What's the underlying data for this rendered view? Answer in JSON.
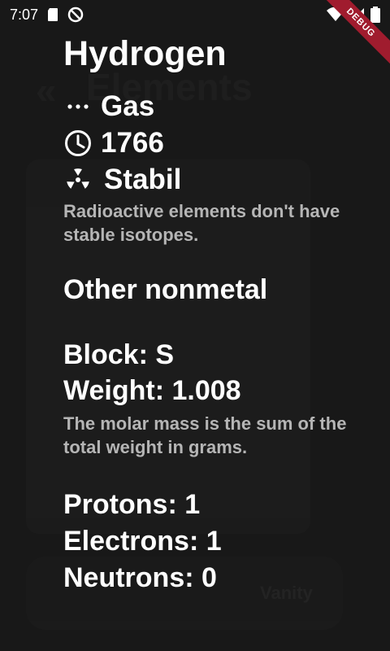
{
  "status_bar": {
    "time": "7:07"
  },
  "debug_banner": "DEBUG",
  "background": {
    "back_icon": "double-chevron-left-icon",
    "title": "Elements",
    "button_label": "Vanity"
  },
  "element": {
    "name": "Hydrogen",
    "phase": "Gas",
    "discovered": "1766",
    "stability": "Stabil",
    "stability_hint": "Radioactive elements don't have stable isotopes.",
    "category": "Other nonmetal",
    "block": "Block: S",
    "weight": "Weight: 1.008",
    "weight_hint": "The molar mass is the sum of the total weight in grams.",
    "protons": "Protons: 1",
    "electrons": "Electrons: 1",
    "neutrons": "Neutrons: 0"
  }
}
